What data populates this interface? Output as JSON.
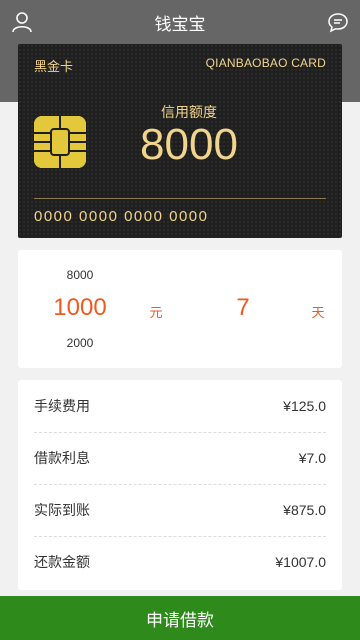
{
  "header": {
    "title": "钱宝宝",
    "left_icon": "user-icon",
    "right_icon": "chat-icon",
    "background": "#666666"
  },
  "card": {
    "type": "黑金卡",
    "brand": "QIANBAOBAO CARD",
    "credit_label": "信用额度",
    "credit_value": "8000",
    "number": "0000 0000 0000 0000",
    "chip_icon": "chip-icon",
    "text_color": "#f2d58c"
  },
  "picker": {
    "amount_prev": "8000",
    "amount_selected": "1000",
    "amount_next": "2000",
    "amount_unit": "元",
    "days_selected": "7",
    "days_unit": "天",
    "accent": "#ef5a1e"
  },
  "fees": [
    {
      "label": "手续费用",
      "value": "¥125.0"
    },
    {
      "label": "借款利息",
      "value": "¥7.0"
    },
    {
      "label": "实际到账",
      "value": "¥875.0"
    },
    {
      "label": "还款金额",
      "value": "¥1007.0"
    }
  ],
  "apply_button": {
    "label": "申请借款",
    "color": "#2f8a1c"
  }
}
